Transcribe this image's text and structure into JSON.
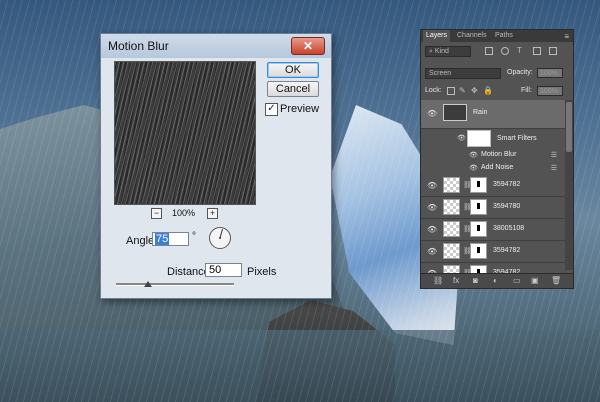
{
  "dialog": {
    "title": "Motion Blur",
    "close_glyph": "✕",
    "zoom": "100%",
    "zoom_minus": "−",
    "zoom_plus": "+",
    "ok_label": "OK",
    "cancel_label": "Cancel",
    "preview_label": "Preview",
    "preview_checked": "✓",
    "angle_label": "Angle:",
    "angle_value": "75",
    "degree_symbol": "°",
    "distance_label": "Distance:",
    "distance_value": "50",
    "distance_unit": "Pixels"
  },
  "layers_panel": {
    "tabs": [
      "Layers",
      "Channels",
      "Paths"
    ],
    "menu_glyph": "≡",
    "kind_label": "Kind",
    "blend_mode": "Screen",
    "opacity_label": "Opacity:",
    "opacity_value": "100%",
    "lock_label": "Lock:",
    "fill_label": "Fill:",
    "fill_value": "100%",
    "rain_layer": "Rain",
    "smart_filters_label": "Smart Filters",
    "filters": [
      "Motion Blur",
      "Add Noise"
    ],
    "layers": [
      "3594782",
      "3594780",
      "38005108",
      "3594782",
      "3594782"
    ],
    "footer_icons": [
      "link-icon",
      "fx-icon",
      "mask-icon",
      "adjustment-icon",
      "folder-icon",
      "new-layer-icon",
      "trash-icon"
    ],
    "footer_glyphs": [
      "⛓",
      "fx",
      "◙",
      "◐",
      "▭",
      "▣",
      "🗑"
    ]
  }
}
